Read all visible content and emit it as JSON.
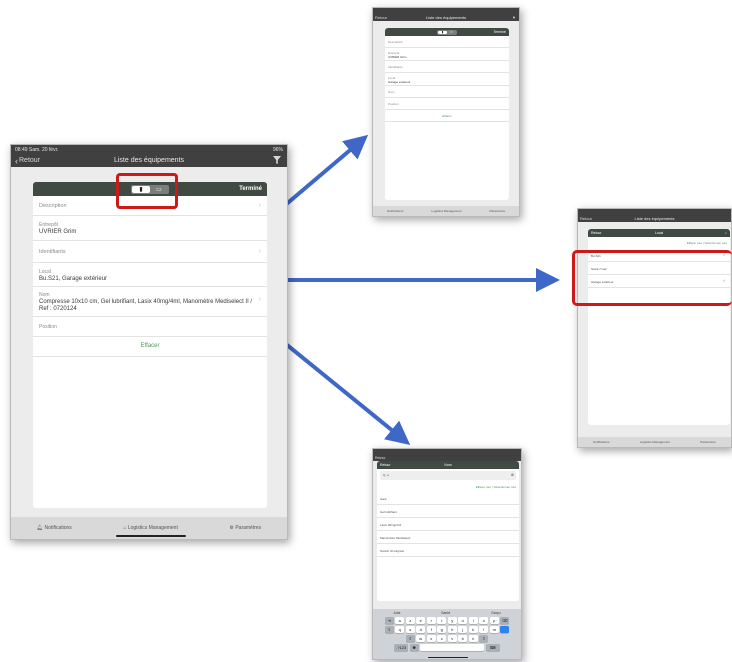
{
  "main": {
    "status": {
      "time": "08:49",
      "date": "Sam. 20 févr.",
      "battery": "96%"
    },
    "nav": {
      "back": "Retour",
      "title": "Liste des équipements"
    },
    "sheet": {
      "done": "Terminé",
      "rows": [
        {
          "label": "Description",
          "value": ""
        },
        {
          "label": "Entrepôt",
          "value": "UVRIER Grim"
        },
        {
          "label": "Identifiants",
          "value": ""
        },
        {
          "label": "Local",
          "value": "Bu.S21, Garage extérieur"
        },
        {
          "label": "Nom",
          "value": "Compresse 10x10 cm, Gel lubrifiant, Lasix 40mg/4ml, Manomètre Mediselect II / Ref : 0720124"
        },
        {
          "label": "Position",
          "value": ""
        }
      ],
      "clear": "Effacer"
    },
    "tabs": [
      "Notifications",
      "Logistics Management",
      "Paramètres"
    ]
  },
  "top": {
    "nav": {
      "back": "Retour",
      "title": "Liste des équipements"
    },
    "done": "Terminé",
    "rows": [
      {
        "label": "Description",
        "value": ""
      },
      {
        "label": "Entrepôt",
        "value": "UVRIER Grim"
      },
      {
        "label": "Identifiants",
        "value": ""
      },
      {
        "label": "Local",
        "value": "Garage extérieur"
      },
      {
        "label": "Nom",
        "value": ""
      },
      {
        "label": "Position",
        "value": ""
      }
    ],
    "clear": "Effacer",
    "tabs": [
      "Notifications",
      "Logistics Management",
      "Paramètres"
    ]
  },
  "right": {
    "nav": {
      "back": "Retour",
      "title": "Liste des équipements"
    },
    "header": {
      "back": "Retour",
      "title": "Local"
    },
    "actions": {
      "clear_all": "Effacer tout",
      "select_all": "Sélectionner tout"
    },
    "items": [
      {
        "label": "Bu.S21",
        "checked": true
      },
      {
        "label": "Stock n°sax",
        "checked": false
      },
      {
        "label": "Garage extérieur",
        "checked": true
      }
    ],
    "tabs": [
      "Notifications",
      "Logistics Management",
      "Paramètres"
    ]
  },
  "bottom": {
    "nav": {
      "back": "Retour"
    },
    "header": {
      "back": "Retour",
      "title": "Nom"
    },
    "search": {
      "value": "Q, a"
    },
    "actions": {
      "clear_all": "Effacer tout",
      "select_all": "Sélectionner tout"
    },
    "items": [
      "Gant",
      "Gel lubrifiant",
      "Lasix 40mg/4ml",
      "Manomètre Mediselect",
      "Scotch chirurgical"
    ],
    "keyboard": {
      "suggestions": [
        "Jolis",
        "Santé",
        "Garçu"
      ],
      "row1": [
        "a",
        "z",
        "e",
        "r",
        "t",
        "y",
        "u",
        "i",
        "o",
        "p"
      ],
      "row2": [
        "q",
        "s",
        "d",
        "f",
        "g",
        "h",
        "j",
        "k",
        "l",
        "m"
      ],
      "row3": [
        "w",
        "x",
        "c",
        "v",
        "b",
        "n"
      ],
      "lang": ".?123"
    }
  },
  "colors": {
    "highlight": "#cc1a1a",
    "arrow": "#3f67c8",
    "header": "#3e4a42",
    "clear": "#4c9a5a"
  }
}
